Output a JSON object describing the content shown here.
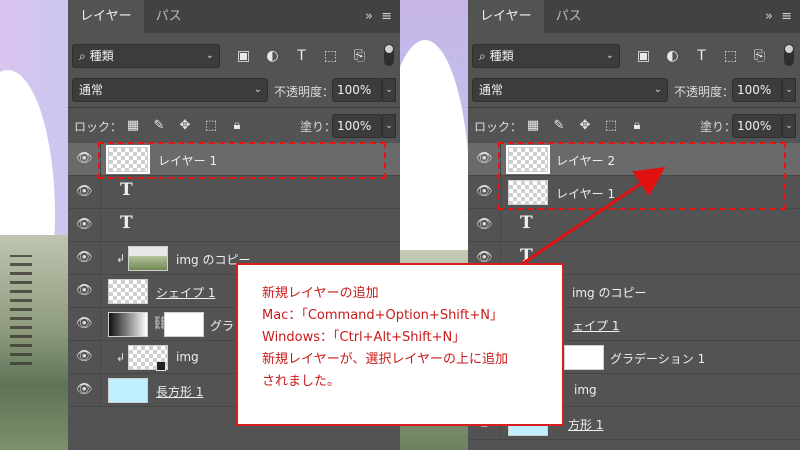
{
  "left_panel": {
    "tabs": [
      {
        "label": "レイヤー"
      },
      {
        "label": "パス"
      }
    ],
    "menu_glyph": "»  ≡",
    "filter_label": "種類",
    "blend_mode": "通常",
    "opacity_label": "不透明度：",
    "opacity_value": "100%",
    "lock_label": "ロック：",
    "fill_label": "塗り：",
    "fill_value": "100%",
    "layers": [
      {
        "name": "レイヤー 1"
      },
      {
        "name": "T"
      },
      {
        "name": "T"
      },
      {
        "name": "img のコピー"
      },
      {
        "name": "シェイプ 1"
      },
      {
        "name": "グラ"
      },
      {
        "name": "img"
      },
      {
        "name": "長方形 1"
      }
    ]
  },
  "right_panel": {
    "tabs": [
      {
        "label": "レイヤー"
      },
      {
        "label": "パス"
      }
    ],
    "menu_glyph": "»  ≡",
    "filter_label": "種類",
    "blend_mode": "通常",
    "opacity_label": "不透明度：",
    "opacity_value": "100%",
    "lock_label": "ロック：",
    "fill_label": "塗り：",
    "fill_value": "100%",
    "layers": [
      {
        "name": "レイヤー 2"
      },
      {
        "name": "レイヤー 1"
      },
      {
        "name": "T"
      },
      {
        "name": "T"
      },
      {
        "name": "img のコピー"
      },
      {
        "name": "ェイプ 1"
      },
      {
        "name": "グラデーション 1"
      },
      {
        "name": "img"
      },
      {
        "name": "方形 1"
      }
    ]
  },
  "callout": {
    "line1": "新規レイヤーの追加",
    "line2": "Mac：「Command+Option+Shift+N」",
    "line3": "Windows：「Ctrl+Alt+Shift+N」",
    "line4": "新規レイヤーが、選択レイヤーの上に追加",
    "line5": "されました。"
  },
  "colors": {
    "panel_bg": "#535353",
    "tab_bar": "#424242",
    "selected_row": "#6a6a6a",
    "highlight": "#e11111",
    "callout_text": "#c81a1a"
  }
}
